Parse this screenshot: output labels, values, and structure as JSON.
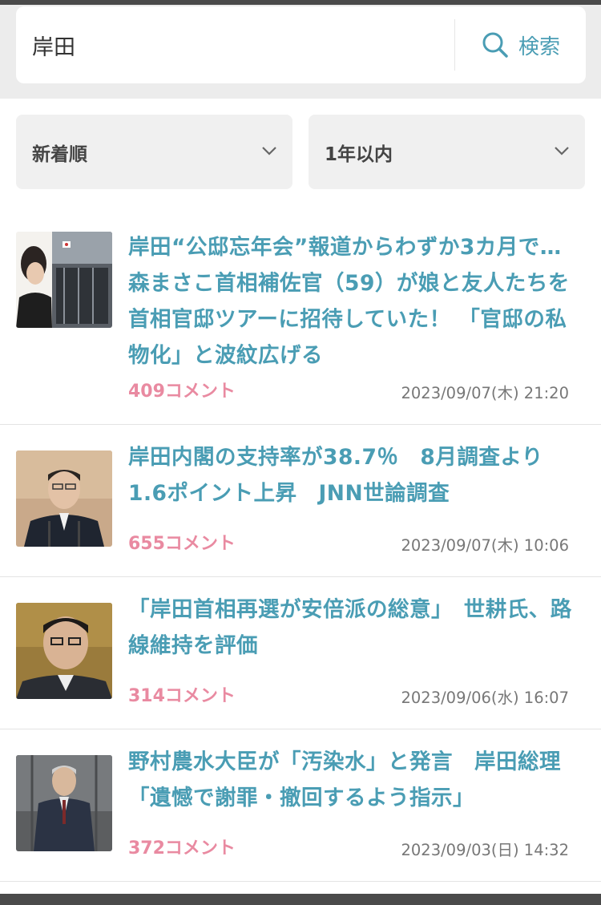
{
  "search": {
    "value": "岸田",
    "button_label": "検索"
  },
  "filters": {
    "sort": "新着順",
    "period": "1年以内"
  },
  "articles": [
    {
      "title": "岸田“公邸忘年会”報道からわずか3カ月で…森まさこ首相補佐官（59）が娘と友人たちを首相官邸ツアーに招待していた！ 「官邸の私物化」と波紋広げる",
      "comments": "409コメント",
      "date": "2023/09/07(木) 21:20"
    },
    {
      "title": "岸田内閣の支持率が38.7％　8月調査より1.6ポイント上昇　JNN世論調査",
      "comments": "655コメント",
      "date": "2023/09/07(木) 10:06"
    },
    {
      "title": "「岸田首相再選が安倍派の総意」　世耕氏、路線維持を評価",
      "comments": "314コメント",
      "date": "2023/09/06(水) 16:07"
    },
    {
      "title": "野村農水大臣が「汚染水」と発言　岸田総理「遺憾で謝罪・撤回するよう指示」",
      "comments": "372コメント",
      "date": "2023/09/03(日) 14:32"
    }
  ],
  "colors": {
    "accent": "#4a9db4",
    "comment": "#e98aa1"
  }
}
